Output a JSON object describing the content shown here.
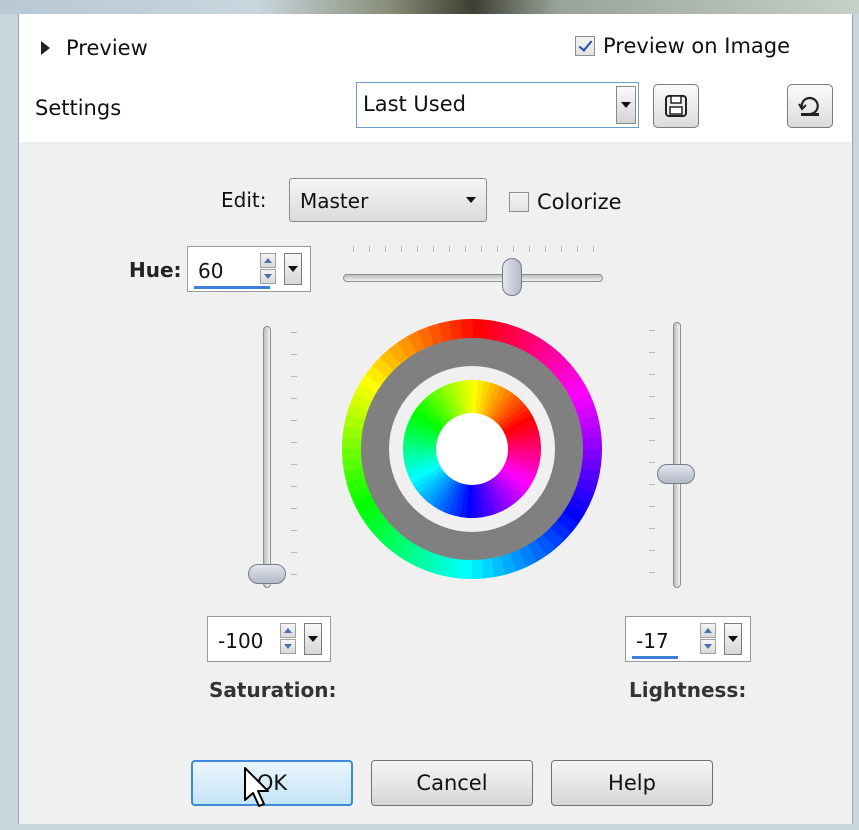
{
  "header": {
    "preview_label": "Preview",
    "preview_on_image": {
      "label": "Preview on Image",
      "checked": true
    },
    "settings_label": "Settings",
    "settings_combo": {
      "value": "Last Used"
    },
    "save_icon": "floppy-disk-icon",
    "reset_icon": "reset-icon"
  },
  "edit": {
    "label": "Edit:",
    "value": "Master",
    "colorize": {
      "label": "Colorize",
      "checked": false
    }
  },
  "hue": {
    "label": "Hue:",
    "value": "60"
  },
  "saturation": {
    "label": "Saturation:",
    "value": "-100"
  },
  "lightness": {
    "label": "Lightness:",
    "value": "-17"
  },
  "buttons": {
    "ok": "OK",
    "cancel": "Cancel",
    "help": "Help"
  },
  "colors": {
    "accent": "#3d7ed8",
    "wheel_band": "#808080"
  }
}
